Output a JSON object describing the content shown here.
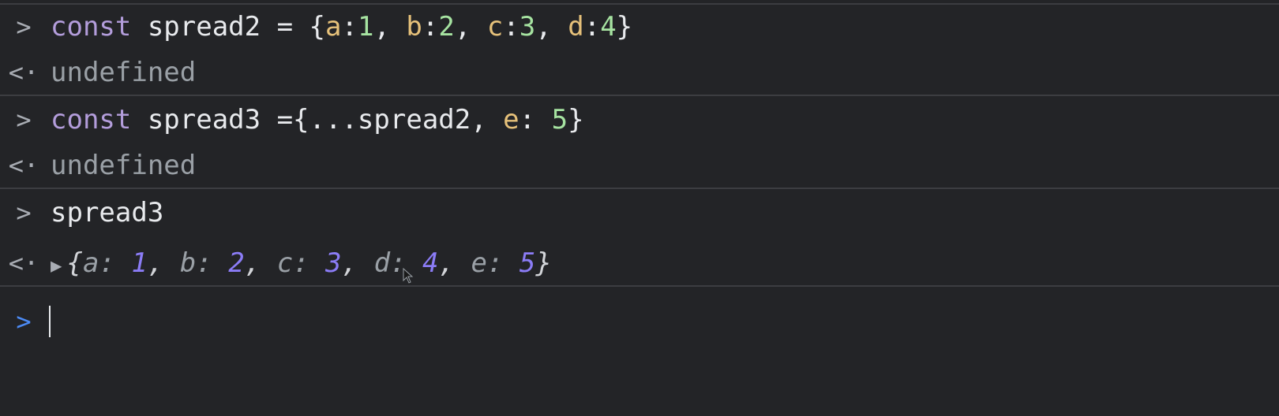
{
  "entries": [
    {
      "input": {
        "prompt": ">",
        "tokens": [
          "const",
          " spread2 = {",
          "a",
          ":",
          "1",
          ", ",
          "b",
          ":",
          "2",
          ", ",
          "c",
          ":",
          "3",
          ", ",
          "d",
          ":",
          "4",
          "}"
        ]
      },
      "output": {
        "prompt": "<·",
        "text": "undefined"
      }
    },
    {
      "input": {
        "prompt": ">",
        "tokens": [
          "const",
          " spread3 ={...spread2, ",
          "e",
          ": ",
          "5",
          "}"
        ]
      },
      "output": {
        "prompt": "<·",
        "text": "undefined"
      }
    },
    {
      "input": {
        "prompt": ">",
        "tokens": [
          "spread3"
        ]
      },
      "output": {
        "prompt": "<·",
        "object": {
          "open": "{",
          "pairs": [
            {
              "key": "a",
              "value": "1"
            },
            {
              "key": "b",
              "value": "2"
            },
            {
              "key": "c",
              "value": "3"
            },
            {
              "key": "d",
              "value": "4"
            },
            {
              "key": "e",
              "value": "5"
            }
          ],
          "close": "}"
        }
      }
    }
  ],
  "active_prompt": ">",
  "colors": {
    "background": "#232427",
    "keyword": "#b39ddb",
    "key": "#e6c17a",
    "number": "#a6e3a1",
    "undefined": "#9aa0a6",
    "object_number": "#8b7cf6",
    "active_prompt": "#4c8bf5"
  },
  "icons": {
    "input_prompt": "chevron-right-icon",
    "output_prompt": "return-arrow-icon",
    "expand": "triangle-right-icon"
  }
}
